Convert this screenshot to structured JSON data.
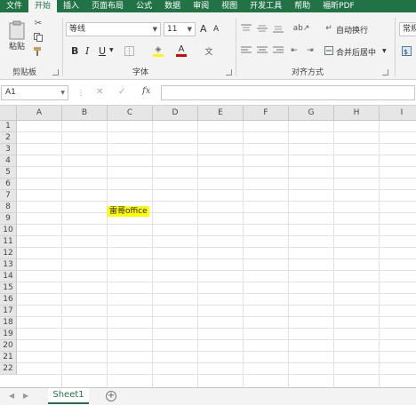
{
  "tabs": [
    "文件",
    "开始",
    "插入",
    "页面布局",
    "公式",
    "数据",
    "审阅",
    "视图",
    "开发工具",
    "帮助",
    "福昕PDF"
  ],
  "active_tab_index": 1,
  "ribbon": {
    "paste_label": "粘贴",
    "clipboard_group": "剪贴板",
    "font_name": "等线",
    "font_size": "11",
    "font_group": "字体",
    "bold": "B",
    "italic": "I",
    "underline": "U",
    "font_size_up": "A",
    "font_size_down": "A",
    "wrap_text": "自动换行",
    "merge_center": "合并后居中",
    "alignment_group": "对齐方式",
    "number_format": "常规"
  },
  "formula_bar": {
    "name_box": "A1",
    "fx_label": "fx",
    "cancel": "✕",
    "confirm": "✓"
  },
  "grid": {
    "columns": [
      "A",
      "B",
      "C",
      "D",
      "E",
      "F",
      "G",
      "H",
      "I"
    ],
    "rows": [
      "1",
      "2",
      "3",
      "4",
      "5",
      "6",
      "7",
      "8",
      "9",
      "10",
      "11",
      "12",
      "13",
      "14",
      "15",
      "16",
      "17",
      "18",
      "19",
      "20",
      "21",
      "22"
    ],
    "cell_c8": "雷哥office"
  },
  "sheet_tabs": {
    "active": "Sheet1",
    "add_label": "+"
  },
  "colors": {
    "accent": "#217346",
    "highlight": "#ffff00"
  }
}
